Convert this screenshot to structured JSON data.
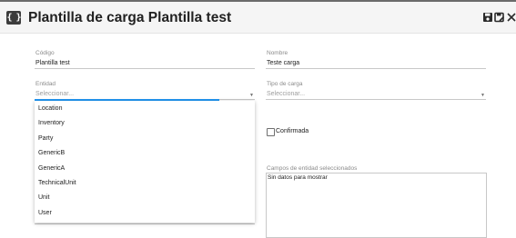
{
  "header": {
    "logo_glyph": "{ }",
    "title": "Plantilla de carga Plantilla test",
    "save_icon": "save-icon",
    "save_as_icon": "save-as-icon",
    "close_icon": "close-icon"
  },
  "form": {
    "codigo": {
      "label": "Código",
      "value": "Plantilla test"
    },
    "nombre": {
      "label": "Nombre",
      "value": "Teste carga"
    },
    "entidad": {
      "label": "Entidad",
      "placeholder": "Seleccionar..."
    },
    "tipo_carga": {
      "label": "Tipo de carga",
      "placeholder": "Seleccionar..."
    },
    "confirmada": {
      "label": "Confirmada",
      "checked": false
    },
    "campos": {
      "label": "Campos de entidad seleccionados",
      "empty_text": "Sin datos para mostrar"
    }
  },
  "entity_options": [
    "Location",
    "Inventory",
    "Party",
    "GenericB",
    "GenericA",
    "TechnicalUnit",
    "Unit",
    "User"
  ],
  "colors": {
    "accent": "#2196f3",
    "header_bg": "#f5f5f5",
    "text": "#212121",
    "label": "#8a8a8a"
  }
}
